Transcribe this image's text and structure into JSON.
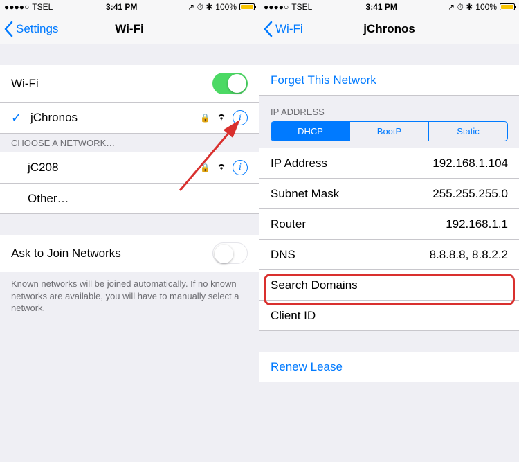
{
  "status": {
    "carrier": "TSEL",
    "signal_dots": "●●●●○",
    "time": "3:41 PM",
    "battery_pct": "100%",
    "indicators": "↗ ⏱ ✱"
  },
  "left": {
    "back_label": "Settings",
    "title": "Wi-Fi",
    "wifi_toggle_label": "Wi-Fi",
    "connected": "jChronos",
    "choose_header": "CHOOSE A NETWORK…",
    "network1": "jC208",
    "other": "Other…",
    "ask_label": "Ask to Join Networks",
    "ask_footer": "Known networks will be joined automatically. If no known networks are available, you will have to manually select a network."
  },
  "right": {
    "back_label": "Wi-Fi",
    "title": "jChronos",
    "forget": "Forget This Network",
    "ip_header": "IP ADDRESS",
    "seg": {
      "dhcp": "DHCP",
      "bootp": "BootP",
      "static": "Static"
    },
    "rows": {
      "ip_label": "IP Address",
      "ip_val": "192.168.1.104",
      "subnet_label": "Subnet Mask",
      "subnet_val": "255.255.255.0",
      "router_label": "Router",
      "router_val": "192.168.1.1",
      "dns_label": "DNS",
      "dns_val": "8.8.8.8, 8.8.2.2",
      "search_label": "Search Domains",
      "search_val": "",
      "client_label": "Client ID",
      "client_val": ""
    },
    "renew": "Renew Lease"
  }
}
